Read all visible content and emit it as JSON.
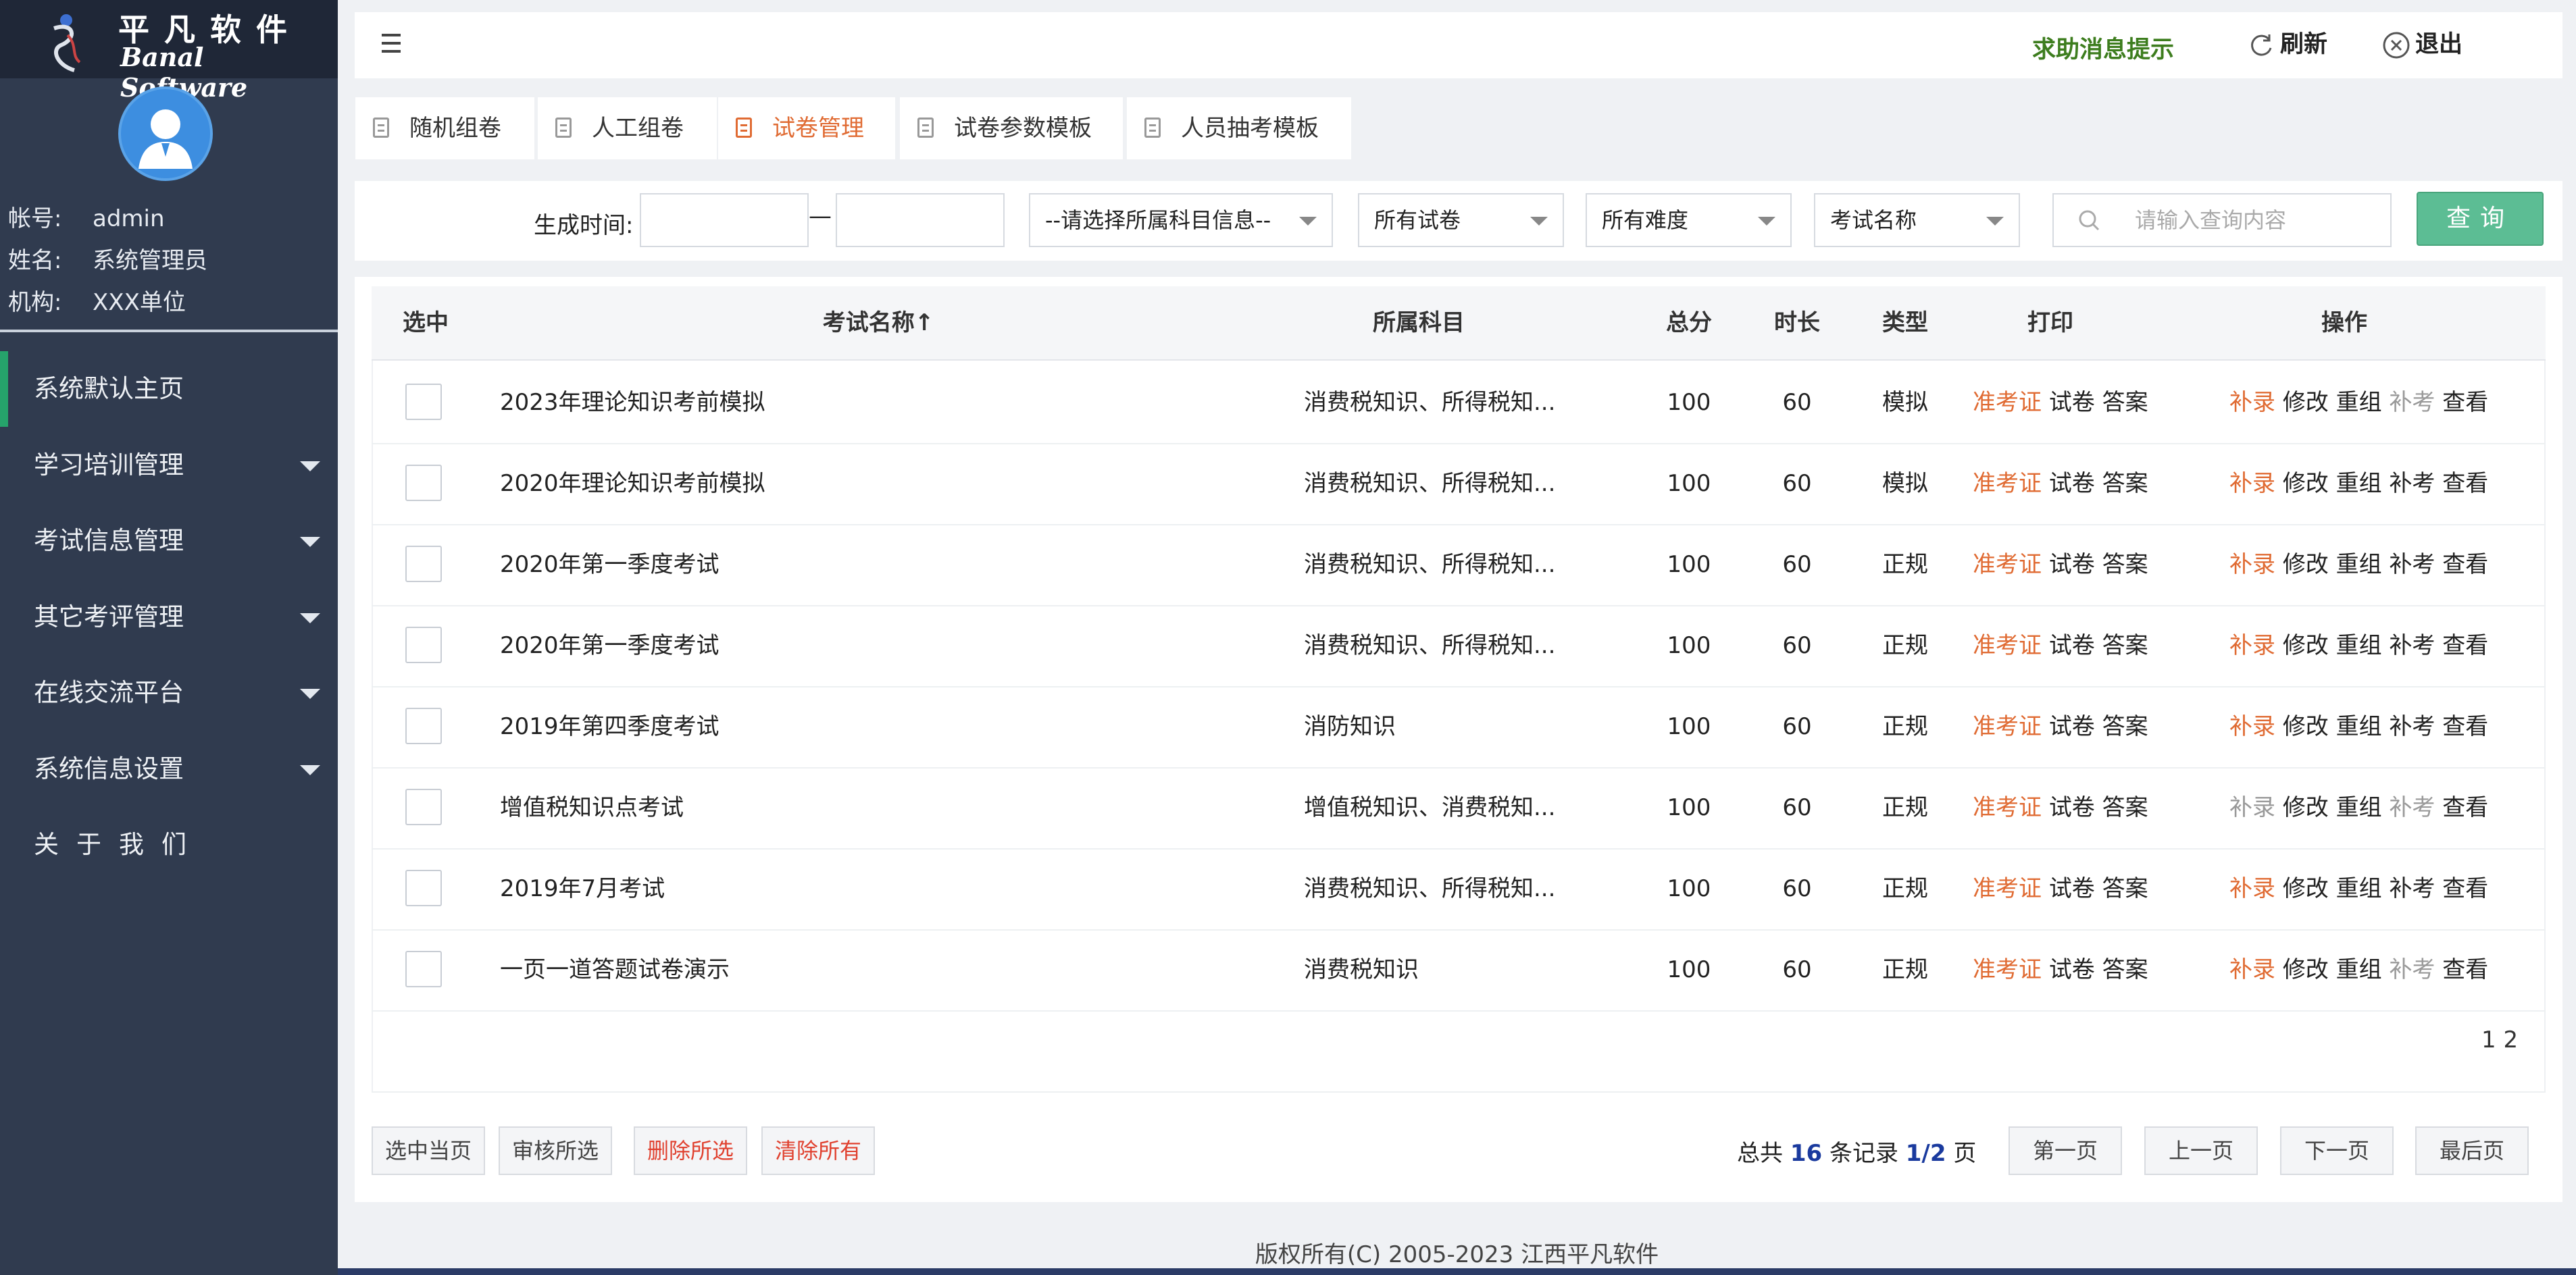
{
  "brand": {
    "name_cn": "平凡软件",
    "name_en": "Banal Software"
  },
  "user": {
    "account_label": "帐号:",
    "account": "admin",
    "name_label": "姓名:",
    "name": "系统管理员",
    "org_label": "机构:",
    "org": "XXX单位"
  },
  "nav": {
    "items": [
      {
        "label": "系统默认主页",
        "active": true,
        "expandable": false
      },
      {
        "label": "学习培训管理",
        "active": false,
        "expandable": true
      },
      {
        "label": "考试信息管理",
        "active": false,
        "expandable": true
      },
      {
        "label": "其它考评管理",
        "active": false,
        "expandable": true
      },
      {
        "label": "在线交流平台",
        "active": false,
        "expandable": true
      },
      {
        "label": "系统信息设置",
        "active": false,
        "expandable": true
      },
      {
        "label": "关于我们",
        "active": false,
        "expandable": false
      }
    ]
  },
  "topbar": {
    "help": "求助消息提示",
    "refresh": "刷新",
    "logout": "退出"
  },
  "tabs": [
    {
      "label": "随机组卷"
    },
    {
      "label": "人工组卷"
    },
    {
      "label": "试卷管理",
      "active": true
    },
    {
      "label": "试卷参数模板"
    },
    {
      "label": "人员抽考模板"
    }
  ],
  "filters": {
    "date_label": "生成时间:",
    "date_sep": "—",
    "subject_select": "--请选择所属科目信息--",
    "paper_select": "所有试卷",
    "difficulty_select": "所有难度",
    "field_select": "考试名称",
    "search_placeholder": "请输入查询内容",
    "query_button": "查询"
  },
  "table": {
    "columns": {
      "select": "选中",
      "name": "考试名称↑",
      "subject": "所属科目",
      "score": "总分",
      "duration": "时长",
      "type": "类型",
      "print": "打印",
      "ops": "操作"
    },
    "print_links": {
      "ticket": "准考证",
      "paper": "试卷",
      "answer": "答案"
    },
    "op_links": {
      "supplement": "补录",
      "edit": "修改",
      "regroup": "重组",
      "makeup": "补考",
      "view": "查看"
    },
    "rows": [
      {
        "name": "2023年理论知识考前模拟",
        "subject": "消费税知识、所得税知...",
        "score": "100",
        "duration": "60",
        "type": "模拟",
        "supplement_enabled": true,
        "makeup_enabled": false
      },
      {
        "name": "2020年理论知识考前模拟",
        "subject": "消费税知识、所得税知...",
        "score": "100",
        "duration": "60",
        "type": "模拟",
        "supplement_enabled": true,
        "makeup_enabled": true
      },
      {
        "name": "2020年第一季度考试",
        "subject": "消费税知识、所得税知...",
        "score": "100",
        "duration": "60",
        "type": "正规",
        "supplement_enabled": true,
        "makeup_enabled": true
      },
      {
        "name": "2020年第一季度考试",
        "subject": "消费税知识、所得税知...",
        "score": "100",
        "duration": "60",
        "type": "正规",
        "supplement_enabled": true,
        "makeup_enabled": true
      },
      {
        "name": "2019年第四季度考试",
        "subject": "消防知识",
        "score": "100",
        "duration": "60",
        "type": "正规",
        "supplement_enabled": true,
        "makeup_enabled": true
      },
      {
        "name": "增值税知识点考试",
        "subject": "增值税知识、消费税知...",
        "score": "100",
        "duration": "60",
        "type": "正规",
        "supplement_enabled": false,
        "makeup_enabled": false
      },
      {
        "name": "2019年7月考试",
        "subject": "消费税知识、所得税知...",
        "score": "100",
        "duration": "60",
        "type": "正规",
        "supplement_enabled": true,
        "makeup_enabled": true
      },
      {
        "name": "一页一道答题试卷演示",
        "subject": "消费税知识",
        "score": "100",
        "duration": "60",
        "type": "正规",
        "supplement_enabled": true,
        "makeup_enabled": false
      }
    ],
    "page_numbers": "1 2"
  },
  "actions": {
    "select_page": "选中当页",
    "review_selected": "审核所选",
    "delete_selected": "删除所选",
    "clear_all": "清除所有"
  },
  "pagination": {
    "total_prefix": "总共",
    "total_count": "16",
    "total_mid": "条记录",
    "page_info": "1/2",
    "page_suffix": "页",
    "first": "第一页",
    "prev": "上一页",
    "next": "下一页",
    "last": "最后页"
  },
  "footer": {
    "copyright": "版权所有(C) 2005-2023 江西平凡软件"
  },
  "colors": {
    "sidebar": "#303b4f",
    "accent_orange": "#e06b33",
    "query_green": "#5cbd94",
    "help_green": "#3d7d1e"
  }
}
